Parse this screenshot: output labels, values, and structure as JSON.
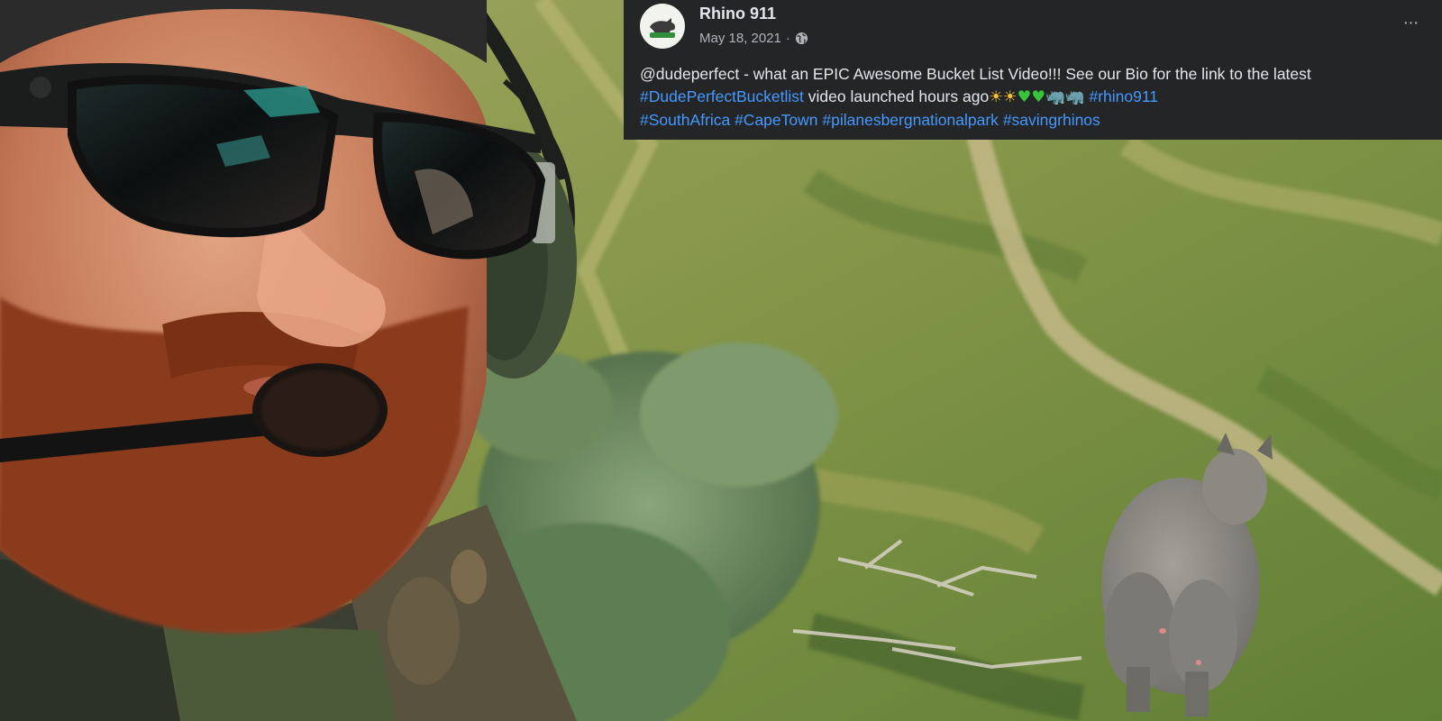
{
  "post": {
    "page_name": "Rhino 911",
    "avatar_text": "RHINO 911",
    "date": "May 18, 2021",
    "separator": "·",
    "audience_icon": "globe-icon",
    "more_icon": "more-options-icon",
    "more_label": "···",
    "text": {
      "mention": "@dudeperfect",
      "intro": " - what an EPIC Awesome Bucket List Video!!! See our Bio for the link to the latest ",
      "hashtag_bucketlist": "#DudePerfectBucketlist",
      "after_hashtag": " video launched hours ago",
      "emoji_sun_1": "☀",
      "emoji_sun_2": "☀",
      "emoji_heart_1": "♥",
      "emoji_heart_2": "♥",
      "emoji_rhino_1": "🦏",
      "emoji_rhino_2": "🦏",
      "hashtag_rhino911": "#rhino911",
      "hashtag_southafrica": "#SouthAfrica",
      "hashtag_capetown": "#CapeTown",
      "hashtag_pilanesberg": "#pilanesbergnationalpark",
      "hashtag_savingrhinos": "#savingrhinos"
    }
  },
  "photo": {
    "subject": "helicopter-selfie-with-rhino",
    "colors": {
      "grass_light": "#8c9a52",
      "grass_dark": "#4f6b33",
      "bush": "#6f8a5e",
      "path": "#b9ae83",
      "skin": "#c47a5c",
      "beard": "#8a3a1c",
      "rhino": "#8e8c85",
      "headset": "#42503a"
    }
  }
}
